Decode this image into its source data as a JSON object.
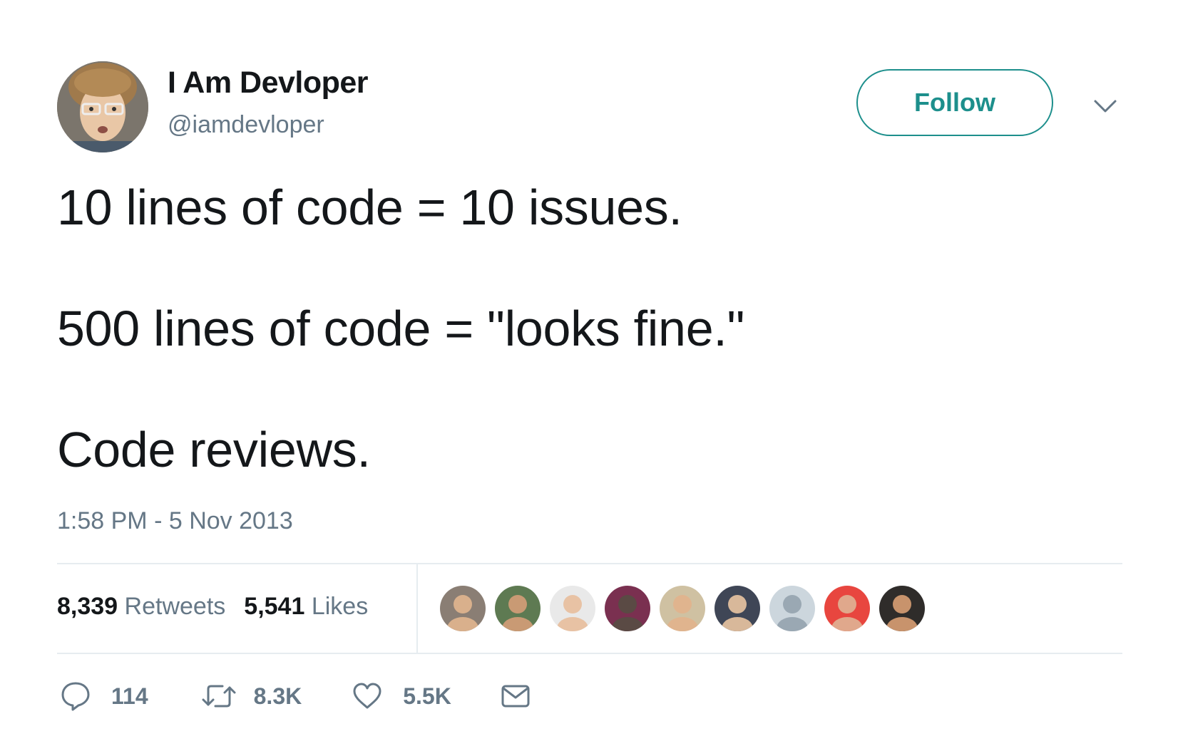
{
  "user": {
    "display_name": "I Am Devloper",
    "handle": "@iamdevloper"
  },
  "header": {
    "follow_label": "Follow"
  },
  "tweet": {
    "lines": [
      "10 lines of code = 10 issues.",
      "500 lines of code = \"looks fine.\"",
      "Code reviews."
    ],
    "timestamp": "1:58 PM - 5 Nov 2013"
  },
  "stats": {
    "retweets_count": "8,339",
    "retweets_label": "Retweets",
    "likes_count": "5,541",
    "likes_label": "Likes"
  },
  "liker_avatars": [
    {
      "name": "liker-avatar-1",
      "bg": "#8a7e74",
      "skin": "#d9b08c"
    },
    {
      "name": "liker-avatar-2",
      "bg": "#5e7a52",
      "skin": "#c99a74"
    },
    {
      "name": "liker-avatar-3",
      "bg": "#e9e9e9",
      "skin": "#e8c2a4"
    },
    {
      "name": "liker-avatar-4",
      "bg": "#7a3050",
      "skin": "#5a4a44"
    },
    {
      "name": "liker-avatar-5",
      "bg": "#cfc1a2",
      "skin": "#e0b48e"
    },
    {
      "name": "liker-avatar-6",
      "bg": "#3f4656",
      "skin": "#d8b89a"
    },
    {
      "name": "liker-avatar-7",
      "bg": "#ccd6dd",
      "skin": "#9aa8b3"
    },
    {
      "name": "liker-avatar-8",
      "bg": "#e8463f",
      "skin": "#e0a88c"
    },
    {
      "name": "liker-avatar-9",
      "bg": "#2f2c2a",
      "skin": "#c8936c"
    }
  ],
  "actions": {
    "replies": "114",
    "retweets": "8.3K",
    "likes": "5.5K"
  },
  "colors": {
    "accent": "#1d8f8c",
    "muted": "#657786",
    "text": "#14171a",
    "divider": "#e6ecf0"
  }
}
